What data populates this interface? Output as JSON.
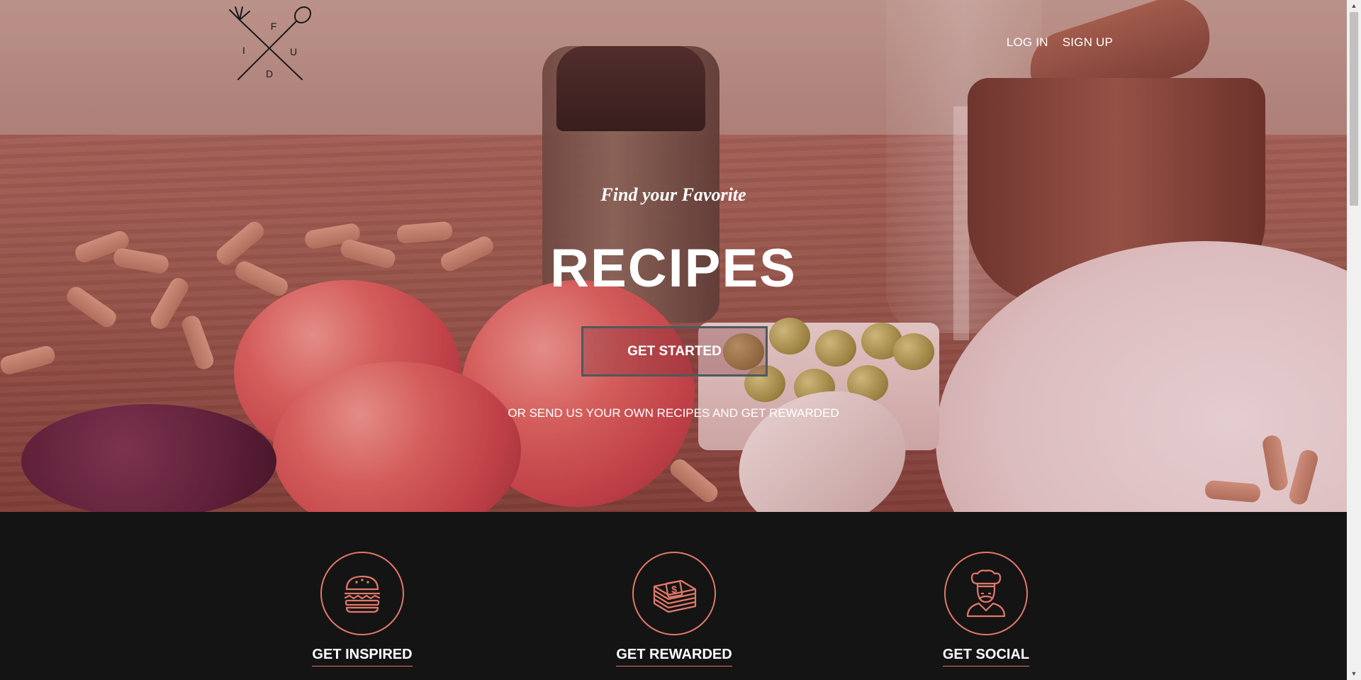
{
  "logo": {
    "letters": [
      "F",
      "I",
      "U",
      "D"
    ],
    "icons": [
      "fork-icon",
      "spoon-icon"
    ]
  },
  "nav": {
    "login": "LOG IN",
    "signup": "SIGN UP"
  },
  "hero": {
    "tagline": "Find your Favorite",
    "headline": "RECIPES",
    "cta": "GET STARTED",
    "subline": "OR SEND US YOUR OWN RECIPES AND GET REWARDED"
  },
  "features": [
    {
      "title": "GET INSPIRED",
      "icon": "burger-icon"
    },
    {
      "title": "GET REWARDED",
      "icon": "money-stack-icon"
    },
    {
      "title": "GET SOCIAL",
      "icon": "chef-icon"
    }
  ],
  "colors": {
    "accent": "#e1786a",
    "dark_background": "#141414"
  }
}
